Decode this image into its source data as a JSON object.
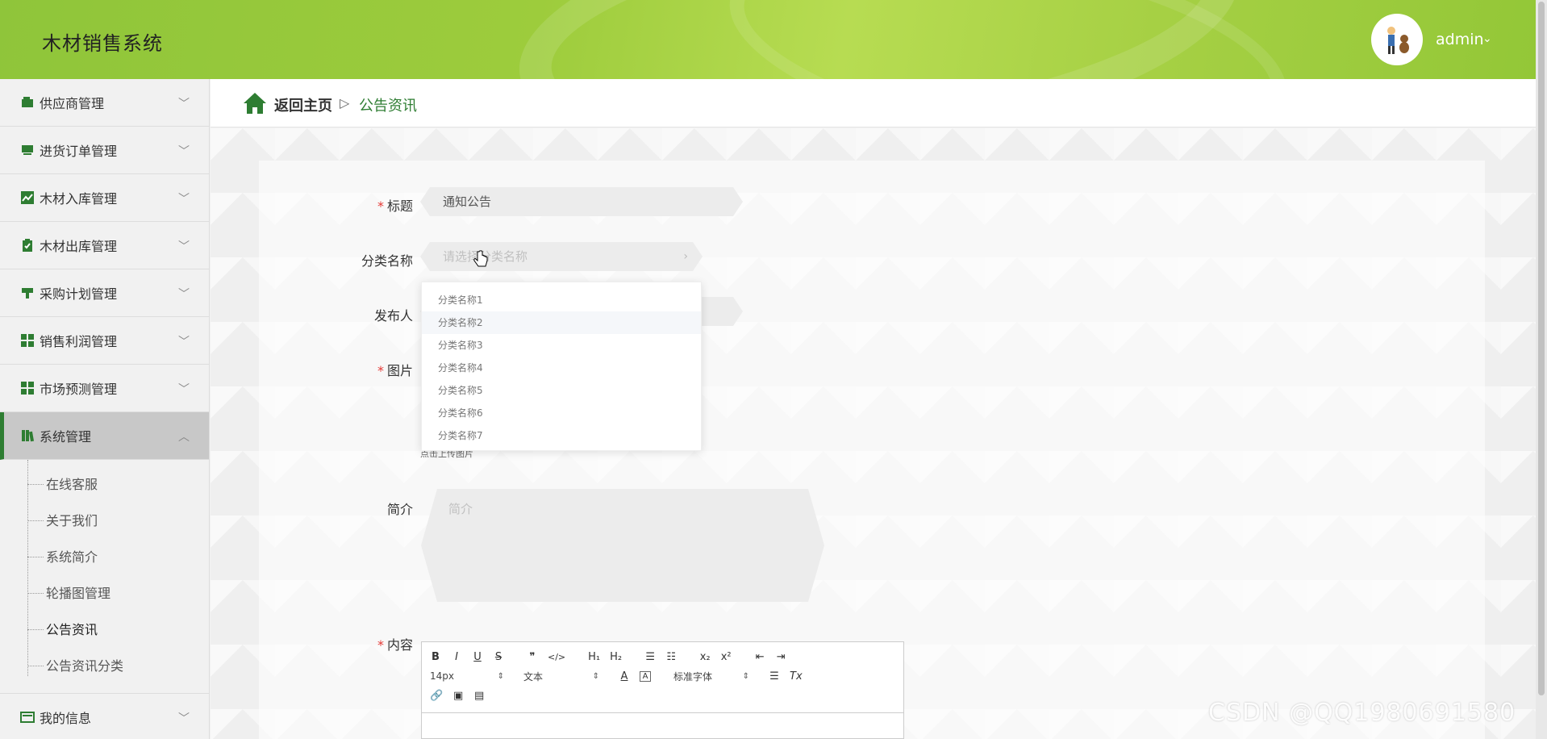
{
  "header": {
    "app_title": "木材销售系统",
    "user_name": "admin",
    "user_caret": "⌄"
  },
  "sidebar": {
    "items": [
      {
        "label": "供应商管理",
        "icon": "wallet-icon"
      },
      {
        "label": "进货订单管理",
        "icon": "inbox-icon"
      },
      {
        "label": "木材入库管理",
        "icon": "chart-line-icon"
      },
      {
        "label": "木材出库管理",
        "icon": "clipboard-check-icon"
      },
      {
        "label": "采购计划管理",
        "icon": "stamp-icon"
      },
      {
        "label": "销售利润管理",
        "icon": "grid-icon"
      },
      {
        "label": "市场预测管理",
        "icon": "grid-icon"
      },
      {
        "label": "系统管理",
        "icon": "book-icon",
        "expanded": true
      }
    ],
    "subitems": [
      "在线客服",
      "关于我们",
      "系统简介",
      "轮播图管理",
      "公告资讯",
      "公告资讯分类"
    ],
    "last_item": {
      "label": "我的信息",
      "icon": "id-card-icon"
    }
  },
  "breadcrumb": {
    "home": "返回主页",
    "separator": "▷",
    "current": "公告资讯"
  },
  "form": {
    "title_label": "标题",
    "title_value": "通知公告",
    "category_label": "分类名称",
    "category_placeholder": "请选择分类名称",
    "publisher_label": "发布人",
    "image_label": "图片",
    "upload_tip": "点击上传图片",
    "intro_label": "简介",
    "intro_placeholder": "简介",
    "content_label": "内容",
    "required_mark": "*"
  },
  "dropdown": {
    "options": [
      "分类名称1",
      "分类名称2",
      "分类名称3",
      "分类名称4",
      "分类名称5",
      "分类名称6",
      "分类名称7"
    ]
  },
  "editor": {
    "row1": [
      "B",
      "I",
      "U",
      "S",
      "❞",
      "</>",
      "H₁",
      "H₂",
      "☰",
      "☷",
      "x₂",
      "x²",
      "⇤",
      "⇥"
    ],
    "font_size": "14px",
    "text_type": "文本",
    "font_family": "标准字体",
    "align": "☰",
    "clear": "Tx",
    "color": "A",
    "bg": "A",
    "row3": [
      "🔗",
      "▣",
      "▤"
    ]
  },
  "watermark": "CSDN @QQ1980691580",
  "colors": {
    "brand_green": "#2e7d32",
    "header_green": "#9dcc3c"
  }
}
